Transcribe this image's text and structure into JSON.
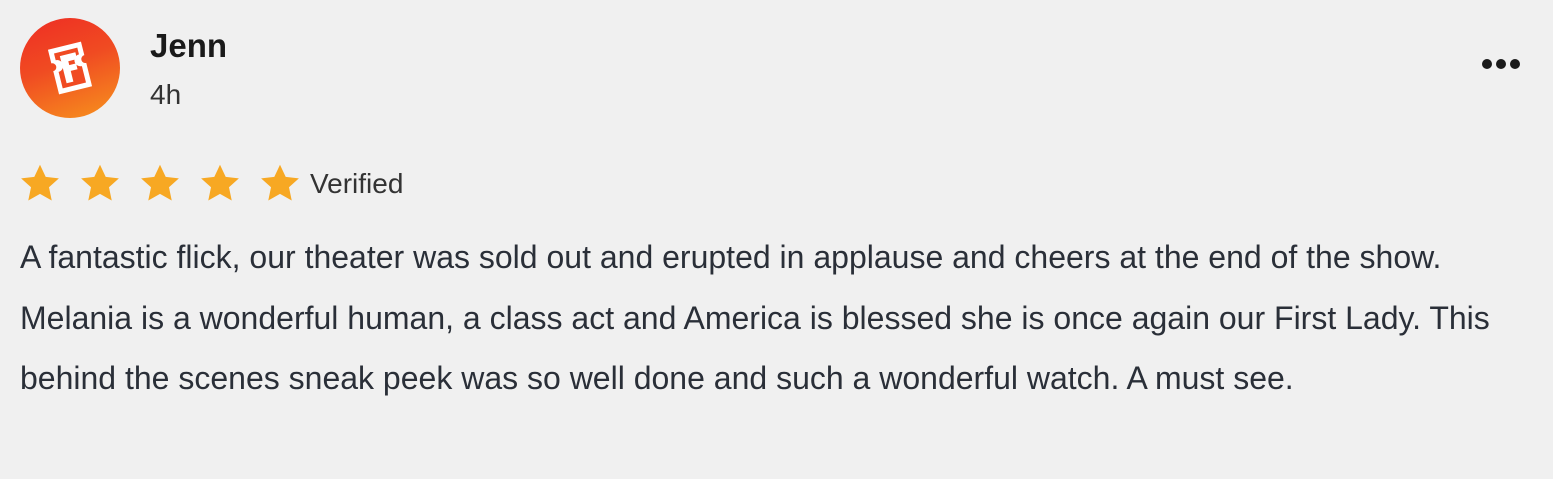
{
  "review": {
    "author": "Jenn",
    "time_ago": "4h",
    "avatar_icon": "fandango-logo-icon",
    "menu_icon": "more-options-icon",
    "rating": 5,
    "rating_max": 5,
    "badge": "Verified",
    "text": "A fantastic flick, our theater was sold out and erupted in applause and cheers at the end of the show. Melania is a wonderful human, a class act and America is blessed she is once again our First Lady. This behind the scenes sneak peek was so well done and such a wonderful watch. A must see."
  },
  "colors": {
    "background": "#f0f0f0",
    "avatar_gradient_start": "#ee2d24",
    "avatar_gradient_end": "#f7931d",
    "star": "#f7a823",
    "text": "#2a2f38"
  }
}
